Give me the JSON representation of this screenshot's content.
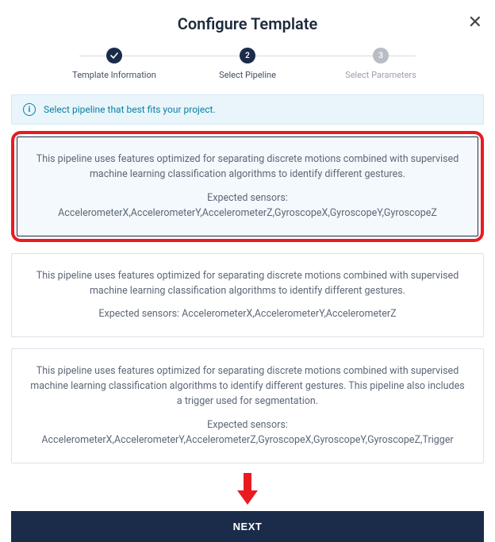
{
  "header": {
    "title": "Configure Template"
  },
  "stepper": {
    "steps": [
      {
        "label": "Template Information",
        "state": "done"
      },
      {
        "label": "Select Pipeline",
        "state": "current",
        "num": "2"
      },
      {
        "label": "Select Parameters",
        "state": "upcoming",
        "num": "3"
      }
    ]
  },
  "info": {
    "text": "Select pipeline that best fits your project."
  },
  "pipelines": [
    {
      "description": "This pipeline uses features optimized for separating discrete motions combined with supervised machine learning classification algorithms to identify different gestures.",
      "sensors_label": "Expected sensors:",
      "sensors": "AccelerometerX,AccelerometerY,AccelerometerZ,GyroscopeX,GyroscopeY,GyroscopeZ",
      "selected": true,
      "highlighted": true
    },
    {
      "description": "This pipeline uses features optimized for separating discrete motions combined with supervised machine learning classification algorithms to identify different gestures.",
      "sensors_label": "Expected sensors: ",
      "sensors": "AccelerometerX,AccelerometerY,AccelerometerZ",
      "inline_sensors": true
    },
    {
      "description": "This pipeline uses features optimized for separating discrete motions combined with supervised machine learning classification algorithms to identify different gestures. This pipeline also includes a trigger used for segmentation.",
      "sensors_label": "Expected sensors:",
      "sensors": "AccelerometerX,AccelerometerY,AccelerometerZ,GyroscopeX,GyroscopeY,GyroscopeZ,Trigger"
    }
  ],
  "buttons": {
    "next": "NEXT"
  },
  "colors": {
    "primary": "#1b2b4a",
    "highlight": "#ea1b1f",
    "info_bg": "#e9f5fa",
    "info_fg": "#0c7fa6"
  }
}
